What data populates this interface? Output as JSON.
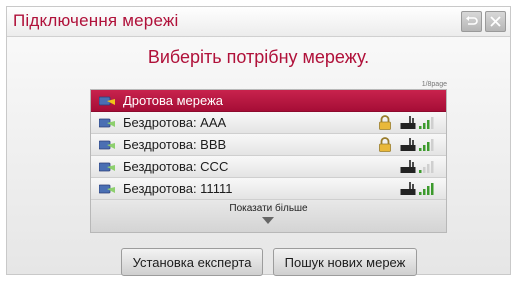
{
  "window": {
    "title": "Підключення мережі",
    "back_icon": "back-arrow-icon",
    "close_icon": "close-icon"
  },
  "heading": "Виберіть потрібну мережу.",
  "page_indicator": "1/8page",
  "networks": [
    {
      "label": "Дротова мережа",
      "icon": "wired-network-icon",
      "selected": true,
      "locked": false,
      "signal": null
    },
    {
      "label": "Бездротова: AAA",
      "icon": "wireless-network-icon",
      "selected": false,
      "locked": true,
      "signal": 3
    },
    {
      "label": "Бездротова: BBB",
      "icon": "wireless-network-icon",
      "selected": false,
      "locked": true,
      "signal": 3
    },
    {
      "label": "Бездротова: CCC",
      "icon": "wireless-network-icon",
      "selected": false,
      "locked": false,
      "signal": 1
    },
    {
      "label": "Бездротова: 11111",
      "icon": "wireless-network-icon",
      "selected": false,
      "locked": false,
      "signal": 4
    }
  ],
  "show_more": "Показати більше",
  "buttons": {
    "expert_setup": "Установка експерта",
    "search_networks": "Пошук нових мереж"
  },
  "colors": {
    "accent": "#b0113a",
    "signal_active": "#3c9a2c",
    "signal_inactive": "#cfcfcf"
  }
}
